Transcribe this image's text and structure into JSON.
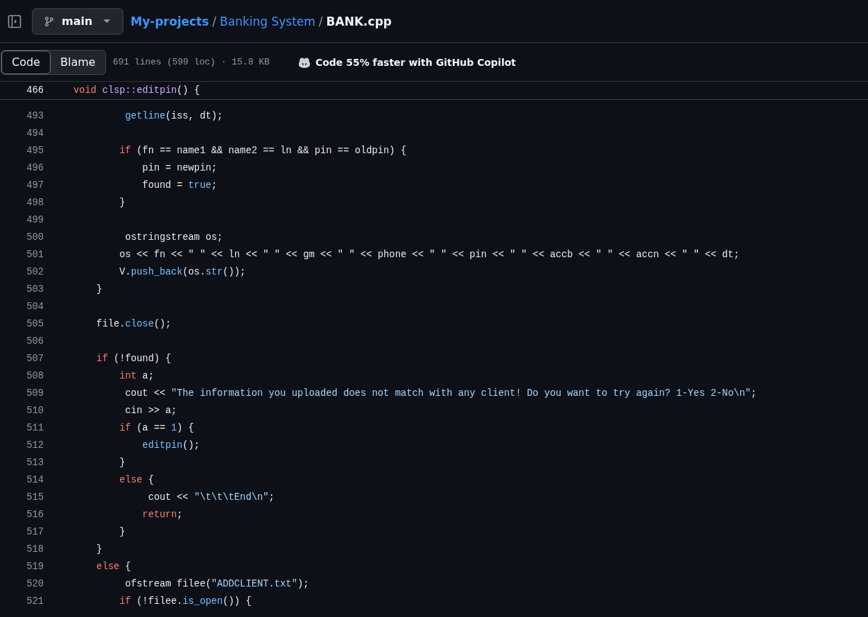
{
  "branch": {
    "name": "main"
  },
  "breadcrumb": [
    {
      "text": "My-projects",
      "kind": "repo"
    },
    {
      "text": "/",
      "kind": "sep"
    },
    {
      "text": "Banking System",
      "kind": "folder"
    },
    {
      "text": "/",
      "kind": "sep"
    },
    {
      "text": "BANK.cpp",
      "kind": "file"
    }
  ],
  "tabs": [
    {
      "label": "Code",
      "selected": true
    },
    {
      "label": "Blame",
      "selected": false
    }
  ],
  "file_info": "691 lines (599 loc) · 15.8 KB",
  "copilot": "Code 55% faster with GitHub Copilot",
  "sticky_line": {
    "number": "466",
    "tokens": [
      {
        "text": "void ",
        "kind": "k"
      },
      {
        "text": "clsp::editpin",
        "kind": "m"
      },
      {
        "text": "() {",
        "kind": "p"
      }
    ]
  },
  "lines": [
    {
      "number": "493",
      "tokens": [
        {
          "text": "         getline",
          "kind": "c"
        },
        {
          "text": "(iss, dt);",
          "kind": "p"
        }
      ]
    },
    {
      "number": "494"
    },
    {
      "number": "495",
      "tokens": [
        {
          "text": "        if",
          "kind": "k"
        },
        {
          "text": " (fn == name1 && name2 == ln && pin == oldpin) {",
          "kind": "p"
        }
      ]
    },
    {
      "number": "496",
      "tokens": [
        {
          "text": "            pin = newpin;",
          "kind": "p"
        }
      ]
    },
    {
      "number": "497",
      "tokens": [
        {
          "text": "            found = ",
          "kind": "p"
        },
        {
          "text": "true",
          "kind": "c"
        },
        {
          "text": ";",
          "kind": "p"
        }
      ]
    },
    {
      "number": "498",
      "tokens": [
        {
          "text": "        }",
          "kind": "p"
        }
      ]
    },
    {
      "number": "499"
    },
    {
      "number": "500",
      "tokens": [
        {
          "text": "         ostringstream os;",
          "kind": "p"
        }
      ]
    },
    {
      "number": "501",
      "tokens": [
        {
          "text": "        os << fn << \" \" << ln << \" \" << gm << \" \" << phone << \" \" << pin << \" \" << accb << \" \" << accn << \" \" << dt;",
          "kind": "p"
        }
      ]
    },
    {
      "number": "502",
      "tokens": [
        {
          "text": "        V.",
          "kind": "p"
        },
        {
          "text": "push_back",
          "kind": "c"
        },
        {
          "text": "(os.",
          "kind": "p"
        },
        {
          "text": "str",
          "kind": "c"
        },
        {
          "text": "());",
          "kind": "p"
        }
      ]
    },
    {
      "number": "503",
      "tokens": [
        {
          "text": "    }",
          "kind": "p"
        }
      ]
    },
    {
      "number": "504"
    },
    {
      "number": "505",
      "tokens": [
        {
          "text": "    file.",
          "kind": "p"
        },
        {
          "text": "close",
          "kind": "c"
        },
        {
          "text": "();",
          "kind": "p"
        }
      ]
    },
    {
      "number": "506"
    },
    {
      "number": "507",
      "tokens": [
        {
          "text": "    if",
          "kind": "k"
        },
        {
          "text": " (!found) {",
          "kind": "p"
        }
      ]
    },
    {
      "number": "508",
      "tokens": [
        {
          "text": "        int",
          "kind": "k"
        },
        {
          "text": " a;",
          "kind": "p"
        }
      ]
    },
    {
      "number": "509",
      "tokens": [
        {
          "text": "         cout << ",
          "kind": "p"
        },
        {
          "text": "\"The information you uploaded does not match with any client! Do you want to try again? 1-Yes 2-No\\n\"",
          "kind": "s"
        },
        {
          "text": ";",
          "kind": "p"
        }
      ]
    },
    {
      "number": "510",
      "tokens": [
        {
          "text": "         cin >> a;",
          "kind": "p"
        }
      ]
    },
    {
      "number": "511",
      "tokens": [
        {
          "text": "        if",
          "kind": "k"
        },
        {
          "text": " (a == ",
          "kind": "p"
        },
        {
          "text": "1",
          "kind": "c"
        },
        {
          "text": ") {",
          "kind": "p"
        }
      ]
    },
    {
      "number": "512",
      "tokens": [
        {
          "text": "            editpin",
          "kind": "c"
        },
        {
          "text": "();",
          "kind": "p"
        }
      ]
    },
    {
      "number": "513",
      "tokens": [
        {
          "text": "        }",
          "kind": "p"
        }
      ]
    },
    {
      "number": "514",
      "tokens": [
        {
          "text": "        else",
          "kind": "k"
        },
        {
          "text": " {",
          "kind": "p"
        }
      ]
    },
    {
      "number": "515",
      "tokens": [
        {
          "text": "             cout << ",
          "kind": "p"
        },
        {
          "text": "\"\\t\\t\\tEnd\\n\"",
          "kind": "s"
        },
        {
          "text": ";",
          "kind": "p"
        }
      ]
    },
    {
      "number": "516",
      "tokens": [
        {
          "text": "            return",
          "kind": "k"
        },
        {
          "text": ";",
          "kind": "p"
        }
      ]
    },
    {
      "number": "517",
      "tokens": [
        {
          "text": "        }",
          "kind": "p"
        }
      ]
    },
    {
      "number": "518",
      "tokens": [
        {
          "text": "    }",
          "kind": "p"
        }
      ]
    },
    {
      "number": "519",
      "tokens": [
        {
          "text": "    else",
          "kind": "k"
        },
        {
          "text": " {",
          "kind": "p"
        }
      ]
    },
    {
      "number": "520",
      "tokens": [
        {
          "text": "         ofstream filee(",
          "kind": "p"
        },
        {
          "text": "\"ADDCLIENT.txt\"",
          "kind": "s"
        },
        {
          "text": ");",
          "kind": "p"
        }
      ]
    },
    {
      "number": "521",
      "tokens": [
        {
          "text": "        if",
          "kind": "k"
        },
        {
          "text": " (!filee.",
          "kind": "p"
        },
        {
          "text": "is_open",
          "kind": "c"
        },
        {
          "text": "()) {",
          "kind": "p"
        }
      ]
    }
  ]
}
